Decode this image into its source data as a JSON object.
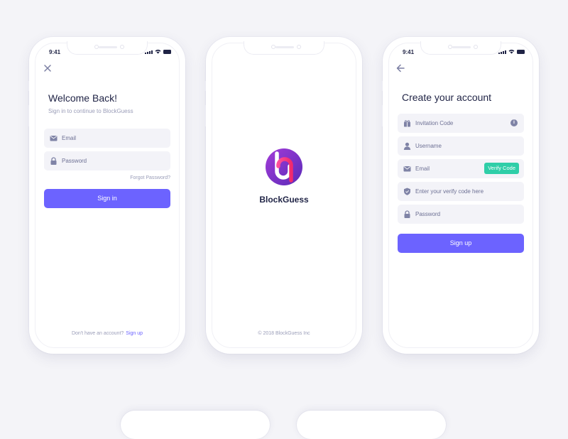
{
  "signin": {
    "status_time": "9:41",
    "title": "Welcome Back!",
    "subtitle": "Sign in to continue to BlockGuess",
    "email_placeholder": "Email",
    "password_placeholder": "Password",
    "forgot_label": "Forgot Password?",
    "signin_label": "Sign in",
    "footer_text": "Don't have an account?",
    "footer_link": "Sign up"
  },
  "splash": {
    "brand_name": "BlockGuess",
    "copyright": "© 2018 BlockGuess Inc"
  },
  "signup": {
    "status_time": "9:41",
    "title": "Create your account",
    "invitation_placeholder": "Invitation Code",
    "username_placeholder": "Username",
    "email_placeholder": "Email",
    "verify_label": "Verify Code",
    "verify_code_placeholder": "Enter your verify code here",
    "password_placeholder": "Password",
    "signup_label": "Sign up"
  },
  "colors": {
    "accent": "#6c63ff",
    "verify_green": "#2fcea8",
    "field_bg": "#f3f3f8",
    "text_dark": "#1f2345",
    "text_muted": "#9a9db8"
  },
  "icons": [
    "close-icon",
    "back-arrow-icon",
    "email-icon",
    "lock-icon",
    "gift-icon",
    "user-icon",
    "shield-icon",
    "info-icon",
    "signal-icon",
    "wifi-icon",
    "battery-icon"
  ]
}
